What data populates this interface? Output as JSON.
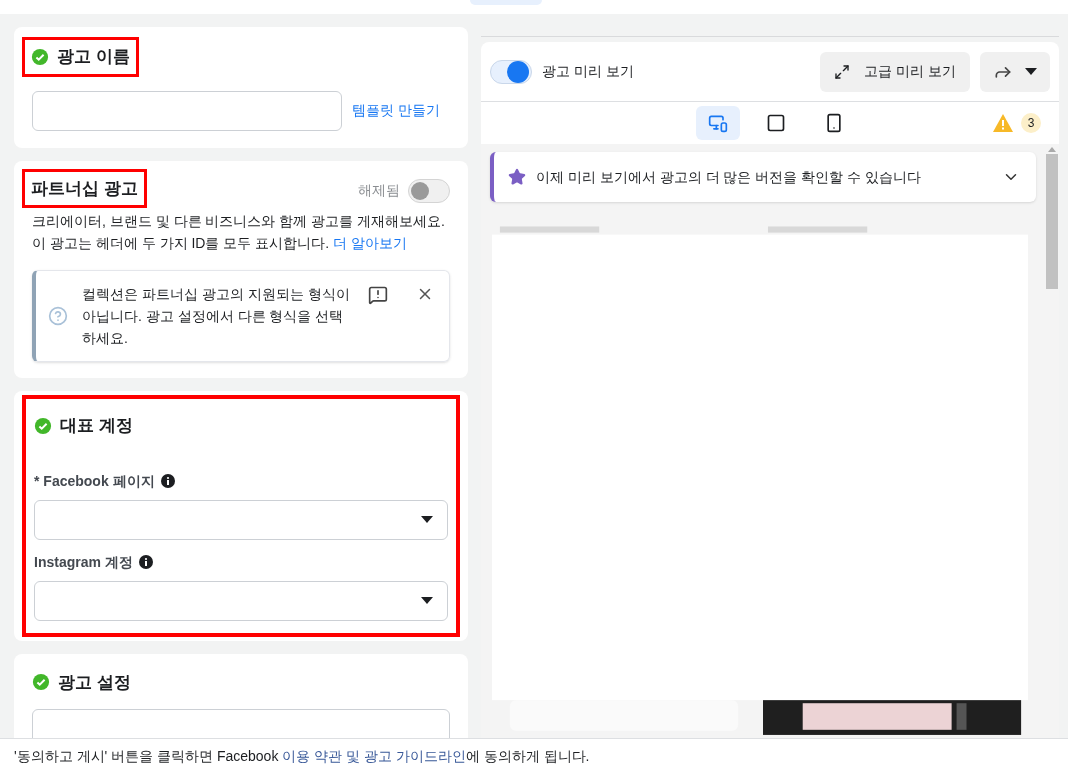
{
  "sections": [
    {
      "kind": "name",
      "title": "광고 이름",
      "complete": true,
      "highlighted": true,
      "link": "템플릿 만들기"
    },
    {
      "kind": "partnership",
      "title": "파트너십 광고",
      "highlighted": true,
      "toggle": {
        "label": "해제됨",
        "on": false
      },
      "description": "크리에이터, 브랜드 및 다른 비즈니스와 함께 광고를 게재해보세요. 이 광고는 헤더에 두 가지 ID를 모두 표시합니다. ",
      "link": "더 알아보기",
      "notice": "컬렉션은 파트너십 광고의 지원되는 형식이 아닙니다. 광고 설정에서 다른 형식을 선택하세요."
    },
    {
      "kind": "identity",
      "title": "대표 계정",
      "complete": true,
      "highlighted": true,
      "fields": [
        {
          "label": "* Facebook 페이지"
        },
        {
          "label": "Instagram 계정"
        }
      ]
    },
    {
      "kind": "setup",
      "title": "광고 설정",
      "complete": true,
      "highlighted": false
    }
  ],
  "preview": {
    "toggle": {
      "label": "광고 미리 보기",
      "on": true
    },
    "advanced_button": "고급 미리 보기",
    "devices": [
      {
        "kind": "responsive",
        "selected": true
      },
      {
        "kind": "square",
        "selected": false
      },
      {
        "kind": "phone",
        "selected": false
      }
    ],
    "warning_count": "3",
    "banner": "이제 미리 보기에서 광고의 더 많은 버전을 확인할 수 있습니다"
  },
  "footer": {
    "before": "'동의하고 게시' 버튼을 클릭하면 Facebook ",
    "link": "이용 약관 및 광고 가이드라인",
    "after": "에 동의하게 됩니다."
  }
}
